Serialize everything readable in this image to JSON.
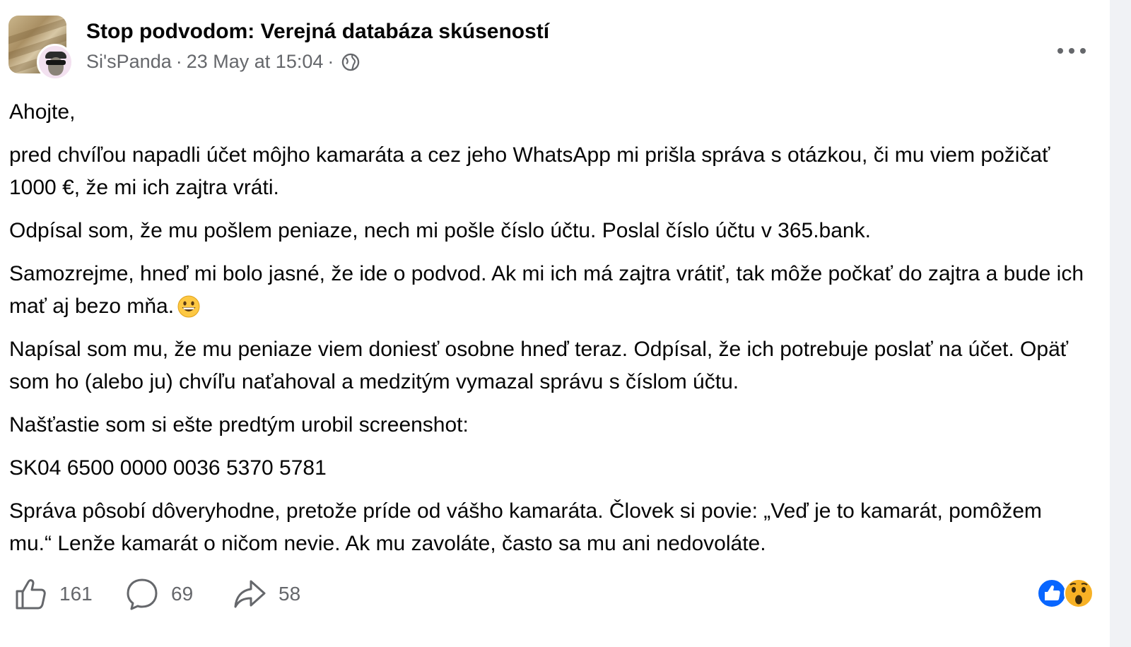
{
  "post": {
    "group_name": "Stop podvodom: Verejná databáza skúseností",
    "author": "Si'sPanda",
    "separator": "·",
    "timestamp": "23 May at 15:04",
    "visibility_icon": "globe-icon",
    "paragraphs": [
      "Ahojte,",
      "pred chvíľou napadli účet môjho kamaráta a cez jeho WhatsApp mi prišla správa s otázkou, či mu viem požičať 1000 €, že mi ich zajtra vráti.",
      "Odpísal som, že mu pošlem peniaze, nech mi pošle číslo účtu. Poslal číslo účtu v 365.bank.",
      "Samozrejme, hneď mi bolo jasné, že ide o podvod. Ak mi ich má zajtra vrátiť, tak môže počkať do zajtra a bude ich mať aj bezo mňa.",
      "Napísal som mu, že mu peniaze viem doniesť osobne hneď teraz. Odpísal, že ich potrebuje poslať na účet. Opäť som ho (alebo ju) chvíľu naťahoval a medzitým vymazal správu s číslom účtu.",
      "Našťastie som si ešte predtým urobil screenshot:",
      "SK04 6500 0000 0036 5370 5781",
      "Správa pôsobí dôveryhodne, pretože príde od vášho kamaráta. Človek si povie: „Veď je to kamarát, pomôžem mu.“ Lenže kamarát o ničom nevie. Ak mu zavoláte, často sa mu ani nedovoláte."
    ],
    "emoji": "grinning-face-emoji"
  },
  "footer": {
    "like_count": "161",
    "comment_count": "69",
    "share_count": "58",
    "reactions": [
      "like-reaction-icon",
      "wow-reaction-icon"
    ]
  },
  "colors": {
    "text": "#050505",
    "secondary": "#65676b",
    "like_blue": "#0866ff",
    "wow_yellow": "#f7b125"
  }
}
